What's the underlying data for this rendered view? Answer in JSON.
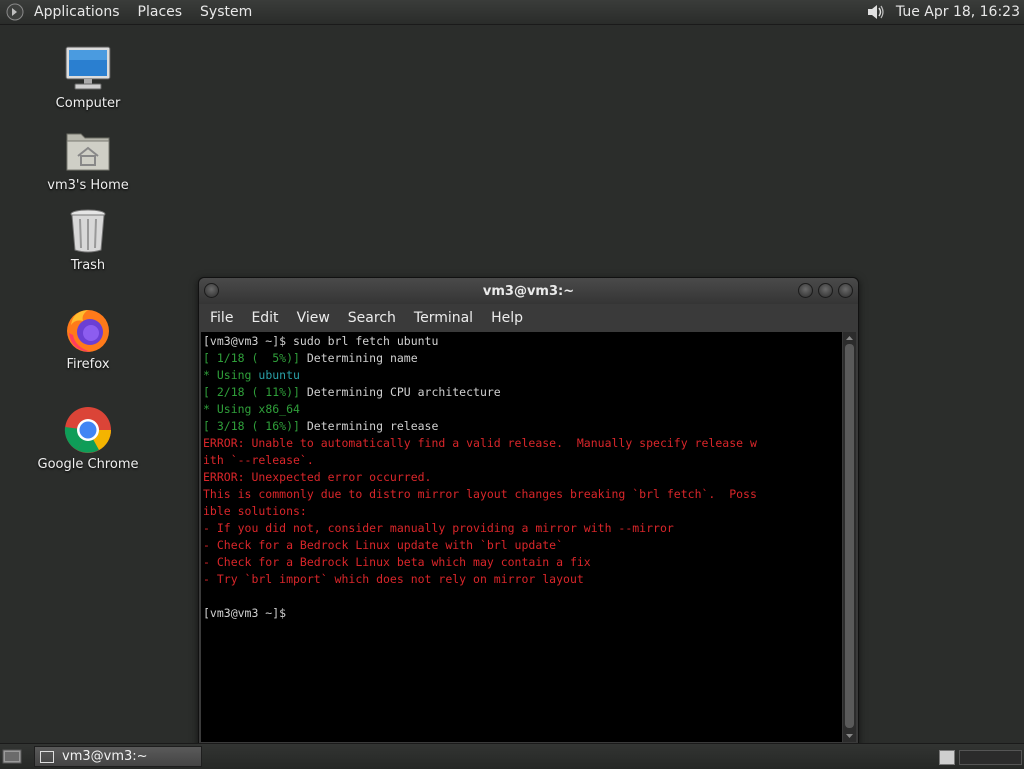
{
  "top_panel": {
    "menus": [
      "Applications",
      "Places",
      "System"
    ],
    "clock": "Tue Apr 18, 16:23"
  },
  "desktop_icons": [
    {
      "label": "Computer",
      "icon": "computer-icon"
    },
    {
      "label": "vm3's Home",
      "icon": "home-folder-icon"
    },
    {
      "label": "Trash",
      "icon": "trash-icon"
    },
    {
      "label": "Firefox",
      "icon": "firefox-icon"
    },
    {
      "label": "Google Chrome",
      "icon": "chrome-icon"
    }
  ],
  "terminal": {
    "title": "vm3@vm3:~",
    "menu": [
      "File",
      "Edit",
      "View",
      "Search",
      "Terminal",
      "Help"
    ],
    "lines": [
      "[vm3@vm3 ~]$ sudo brl fetch ubuntu",
      "[ 1/18 (  5%)] ",
      "Determining name",
      "* Using ",
      "ubuntu",
      "[ 2/18 ( 11%)] ",
      "Determining CPU architecture",
      "* Using ",
      "x86_64",
      "[ 3/18 ( 16%)] ",
      "Determining release",
      "ERROR: Unable to automatically find a valid release.  Manually specify release w",
      "ith `--release`.",
      "ERROR: Unexpected error occurred.",
      "This is commonly due to distro mirror layout changes breaking `brl fetch`.  Poss",
      "ible solutions:",
      "- If you did not, consider manually providing a mirror with --mirror",
      "- Check for a Bedrock Linux update with `brl update`",
      "- Check for a Bedrock Linux beta which may contain a fix",
      "- Try `brl import` which does not rely on mirror layout",
      "",
      "[vm3@vm3 ~]$ "
    ]
  },
  "taskbar": {
    "task_label": "vm3@vm3:~"
  }
}
